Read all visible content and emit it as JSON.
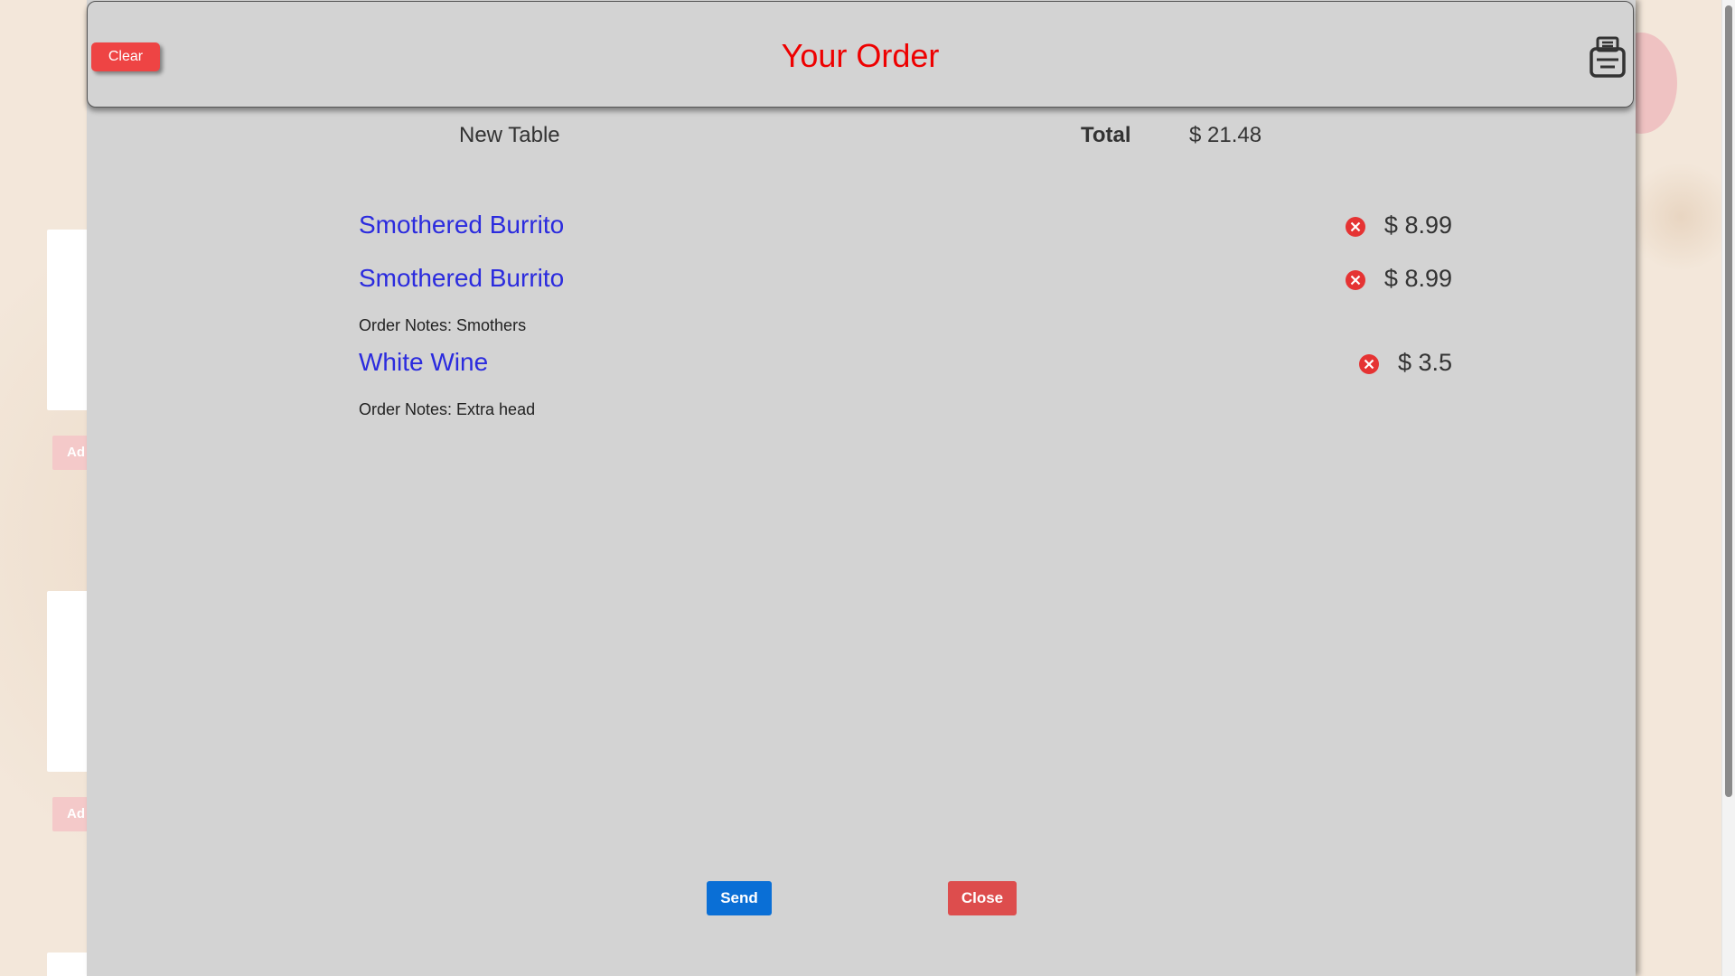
{
  "background": {
    "add_button_partial": "Ad"
  },
  "header": {
    "clear_label": "Clear",
    "title": "Your Order",
    "print_icon": "printer-icon"
  },
  "summary": {
    "table_name": "New Table",
    "total_label": "Total",
    "total_value": "$ 21.48"
  },
  "items": [
    {
      "name": "Smothered Burrito",
      "price": "$ 8.99",
      "note": ""
    },
    {
      "name": "Smothered Burrito",
      "price": "$ 8.99",
      "note": "Order Notes: Smothers"
    },
    {
      "name": "White Wine",
      "price": "$ 3.5",
      "note": "Order Notes: Extra head"
    }
  ],
  "footer": {
    "send_label": "Send",
    "close_label": "Close"
  },
  "colors": {
    "title": "#ee0000",
    "item_link": "#2b2bde",
    "clear_button": "#ee4444",
    "send_button": "#0a6fd6",
    "close_button": "#dd4d4d",
    "remove_icon": "#e53333",
    "modal_background": "#d3d3d3"
  }
}
